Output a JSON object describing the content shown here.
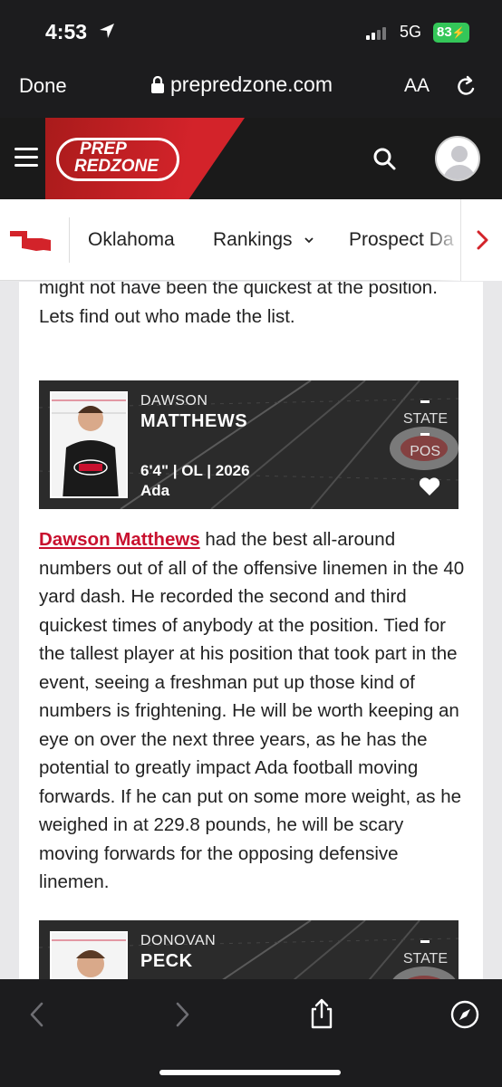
{
  "status_bar": {
    "time": "4:53",
    "network": "5G",
    "battery": "83"
  },
  "browser": {
    "done_label": "Done",
    "url": "prepredzone.com",
    "text_size_label": "AA"
  },
  "site": {
    "logo_line1": "PREP",
    "logo_line2": "REDZONE"
  },
  "nav": {
    "items": [
      "Oklahoma",
      "Rankings",
      "Prospect Da"
    ]
  },
  "article": {
    "intro": "might not have been the quickest at the position. Lets find out who made the list.",
    "players": [
      {
        "first_name": "DAWSON",
        "last_name": "MATTHEWS",
        "height": "6'4\"",
        "position": "OL",
        "class_year": "2026",
        "town": "Ada",
        "state_label": "STATE",
        "pos_label": "POS"
      },
      {
        "first_name": "DONOVAN",
        "last_name": "PECK",
        "state_label": "STATE"
      }
    ],
    "body_link": "Dawson Matthews",
    "body_text": " had the best all-around numbers out of all of the offensive linemen in the 40 yard dash. He recorded the second and third quickest times of anybody at the position. Tied for the tallest player at his position that took part in the event, seeing a freshman put up those kind of numbers is frightening. He will be worth keeping an eye on over the next three years, as he has the potential to greatly impact Ada football moving forwards. If he can put on some more weight, as he weighed in at 229.8 pounds, he will be scary moving forwards for the opposing defensive linemen.",
    "card_sep": " | "
  },
  "colors": {
    "brand_red": "#d3232a",
    "link_red": "#c8102e",
    "battery_green": "#34c759"
  }
}
